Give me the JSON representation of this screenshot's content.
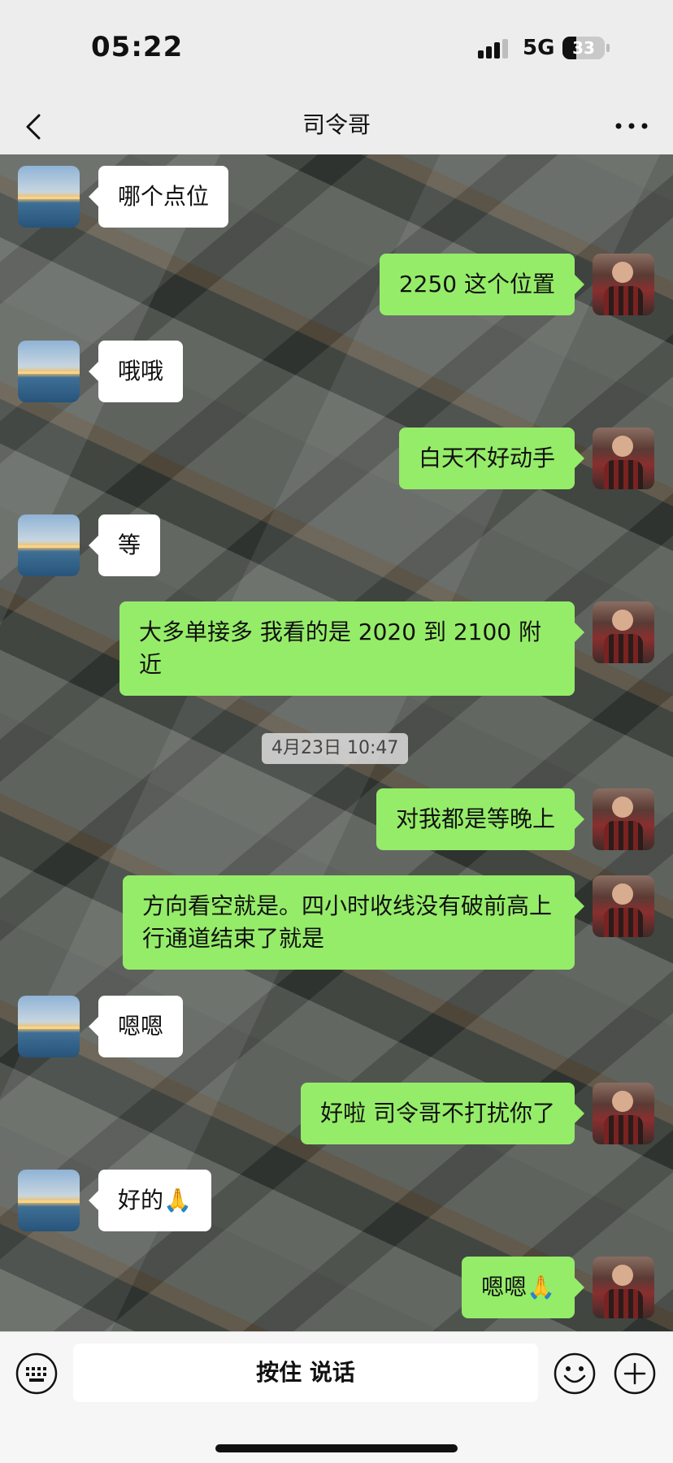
{
  "status_bar": {
    "time": "05:22",
    "network": "5G",
    "battery": "33",
    "battery_level": 0.33
  },
  "nav": {
    "title": "司令哥"
  },
  "chat": {
    "timestamp": "4月23日 10:47",
    "messages": [
      {
        "side": "left",
        "text": "哪个点位"
      },
      {
        "side": "right",
        "text": "2250 这个位置"
      },
      {
        "side": "left",
        "text": "哦哦"
      },
      {
        "side": "right",
        "text": "白天不好动手"
      },
      {
        "side": "left",
        "text": "等"
      },
      {
        "side": "right",
        "text": "大多单接多 我看的是 2020 到 2100 附近"
      },
      {
        "side": "right",
        "text": "对我都是等晚上"
      },
      {
        "side": "right",
        "text": "方向看空就是。四小时收线没有破前高上行通道结束了就是"
      },
      {
        "side": "left",
        "text": "嗯嗯"
      },
      {
        "side": "right",
        "text": "好啦 司令哥不打扰你了"
      },
      {
        "side": "left",
        "text": "好的🙏"
      },
      {
        "side": "right",
        "text": "嗯嗯🙏"
      }
    ]
  },
  "input": {
    "hold_to_talk": "按住 说话"
  },
  "icons": {
    "back": "chevron-left-icon",
    "more": "more-icon",
    "keyboard": "keyboard-icon",
    "emoji": "emoji-icon",
    "plus": "plus-icon"
  },
  "colors": {
    "self_bubble": "#95ec69",
    "other_bubble": "#ffffff",
    "bar_background": "#ededed"
  }
}
